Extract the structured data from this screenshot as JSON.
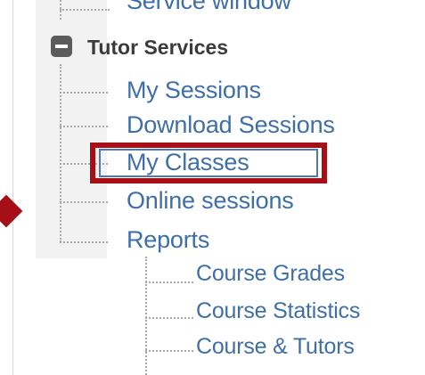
{
  "tree": {
    "cut_item_label": "Service window",
    "group": {
      "label": "Tutor Services",
      "expanded": true
    },
    "items": [
      {
        "label": "My Sessions"
      },
      {
        "label": "Download Sessions"
      },
      {
        "label": "My Classes",
        "highlighted": true
      },
      {
        "label": "Online sessions"
      },
      {
        "label": "Reports"
      }
    ],
    "report_children": [
      {
        "label": "Course Grades"
      },
      {
        "label": "Course Statistics"
      },
      {
        "label": "Course & Tutors"
      }
    ]
  },
  "colors": {
    "link": "#3f6fa9",
    "highlight": "#a50f15",
    "header_text": "#3b3b3b",
    "tree_lines": "#a9a9a9"
  },
  "icons": {
    "collapse": "minus-box-icon",
    "pointer": "arrow-icon"
  }
}
